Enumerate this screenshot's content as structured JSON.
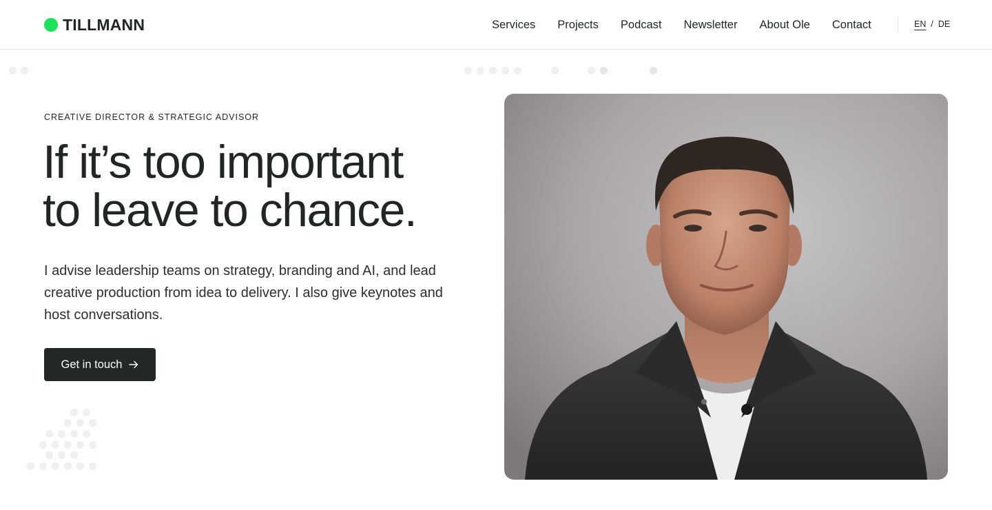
{
  "brand": {
    "name": "TILLMANN",
    "accent": "#1ee05a"
  },
  "nav": {
    "items": [
      {
        "label": "Services",
        "key": "services"
      },
      {
        "label": "Projects",
        "key": "projects"
      },
      {
        "label": "Podcast",
        "key": "podcast"
      },
      {
        "label": "Newsletter",
        "key": "newsletter"
      },
      {
        "label": "About Ole",
        "key": "about"
      },
      {
        "label": "Contact",
        "key": "contact"
      }
    ]
  },
  "lang": {
    "current": "EN",
    "separator": "/",
    "other": "DE"
  },
  "hero": {
    "eyebrow": "CREATIVE DIRECTOR & STRATEGIC ADVISOR",
    "headline_line1": "If it’s too important",
    "headline_line2": "to leave to chance.",
    "lead": "I advise leadership teams on strategy, branding and AI, and lead creative production from idea to delivery. I also give keynotes and host conversations.",
    "cta_label": "Get in touch",
    "cta_icon": "arrow-right-icon",
    "portrait_icon": "portrait-photo"
  },
  "colors": {
    "text": "#1f2623",
    "button_bg": "#222826",
    "divider": "#e6e6e6"
  }
}
